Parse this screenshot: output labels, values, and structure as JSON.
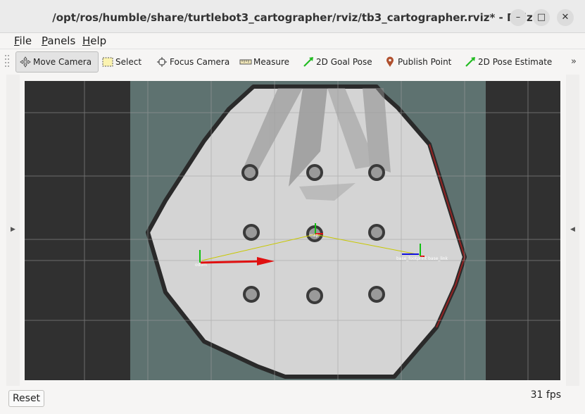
{
  "window": {
    "title": "/opt/ros/humble/share/turtlebot3_cartographer/rviz/tb3_cartographer.rviz* - RViz",
    "controls": [
      "–",
      "□",
      "✕"
    ]
  },
  "menu": [
    {
      "label": "File",
      "mnemonic": "F",
      "rest": "ile"
    },
    {
      "label": "Panels",
      "mnemonic": "P",
      "rest": "anels"
    },
    {
      "label": "Help",
      "mnemonic": "H",
      "rest": "elp"
    }
  ],
  "toolbar": {
    "tools": [
      {
        "label": "Move Camera",
        "icon": "move-camera-icon",
        "active": true
      },
      {
        "label": "Select",
        "icon": "select-icon",
        "active": false
      },
      {
        "label": "Focus Camera",
        "icon": "focus-camera-icon",
        "active": false
      },
      {
        "label": "Measure",
        "icon": "measure-icon",
        "active": false
      },
      {
        "label": "2D Goal Pose",
        "icon": "goal-pose-arrow-icon",
        "active": false
      },
      {
        "label": "Publish Point",
        "icon": "map-pin-icon",
        "active": false
      },
      {
        "label": "2D Pose Estimate",
        "icon": "pose-estimate-arrow-icon",
        "active": false
      }
    ],
    "overflow": "»"
  },
  "viewport": {
    "frame_labels": {
      "odom": "odom",
      "map": "map",
      "base": "base_footprint base_link"
    },
    "colors": {
      "background": "#303030",
      "unknown": "#5e7270",
      "free": "#d4d4d4",
      "wall": "#2a2a2a",
      "grid": "#a0a0a0",
      "x_axis": "#e01010",
      "y_axis": "#10c010",
      "z_axis": "#1010e0",
      "tf_link": "#c8c800"
    }
  },
  "status": {
    "reset_label": "Reset",
    "fps": "31 fps"
  }
}
